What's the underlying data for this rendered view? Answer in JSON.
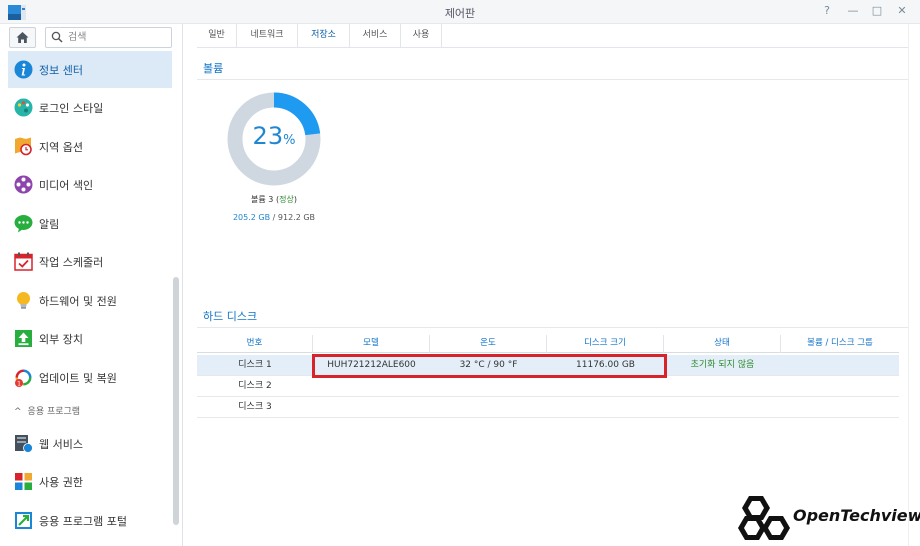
{
  "window": {
    "title": "제어판",
    "help": "?",
    "minimize": "—",
    "maximize": "□",
    "close": "✕"
  },
  "sidebar": {
    "search_placeholder": "검색",
    "items": [
      {
        "label": "정보 센터",
        "icon": "info-icon"
      },
      {
        "label": "로그인 스타일",
        "icon": "palette-icon"
      },
      {
        "label": "지역 옵션",
        "icon": "clock-map-icon"
      },
      {
        "label": "미디어 색인",
        "icon": "film-reel-icon"
      },
      {
        "label": "알림",
        "icon": "chat-bubble-icon"
      },
      {
        "label": "작업 스케줄러",
        "icon": "calendar-check-icon"
      },
      {
        "label": "하드웨어 및 전원",
        "icon": "lightbulb-icon"
      },
      {
        "label": "외부 장치",
        "icon": "upload-icon"
      },
      {
        "label": "업데이트 및 복원",
        "icon": "update-icon",
        "badge": "1"
      }
    ],
    "group": {
      "label": "응용 프로그램",
      "chevron": "^"
    },
    "app_items": [
      {
        "label": "웹 서비스",
        "icon": "web-service-icon"
      },
      {
        "label": "사용 권한",
        "icon": "permission-icon"
      },
      {
        "label": "응용 프로그램 포털",
        "icon": "portal-icon"
      }
    ]
  },
  "tabs": [
    "일반",
    "네트워크",
    "저장소",
    "서비스",
    "사용"
  ],
  "active_tab": "저장소",
  "volume": {
    "section_title": "볼륨",
    "percent": "23",
    "percent_unit": "%",
    "usage_fraction": 0.23,
    "name": "볼륨 3 (",
    "status": "정상",
    "name_end": ")",
    "used": "205.2 GB",
    "total": " / 912.2 GB"
  },
  "disks": {
    "section_title": "하드 디스크",
    "columns": [
      "번호",
      "모델",
      "온도",
      "디스크 크기",
      "상태",
      "볼륨 / 디스크 그룹"
    ],
    "rows": [
      {
        "num": "디스크 1",
        "model": "HUH721212ALE600",
        "temp": "32 °C / 90 °F",
        "size": "11176.00 GB",
        "status": "초기화 되지 않음",
        "group": ""
      },
      {
        "num": "디스크 2",
        "model": "",
        "temp": "",
        "size": "",
        "status": "",
        "group": ""
      },
      {
        "num": "디스크 3",
        "model": "",
        "temp": "",
        "size": "",
        "status": "",
        "group": ""
      }
    ]
  },
  "watermark": {
    "text": "OpenTechview"
  },
  "colors": {
    "accent": "#0f73c9",
    "donut_used": "#1e9bf0",
    "donut_free": "#cfd8e0",
    "ok": "#2f8b2f",
    "highlight": "#d9232b"
  }
}
